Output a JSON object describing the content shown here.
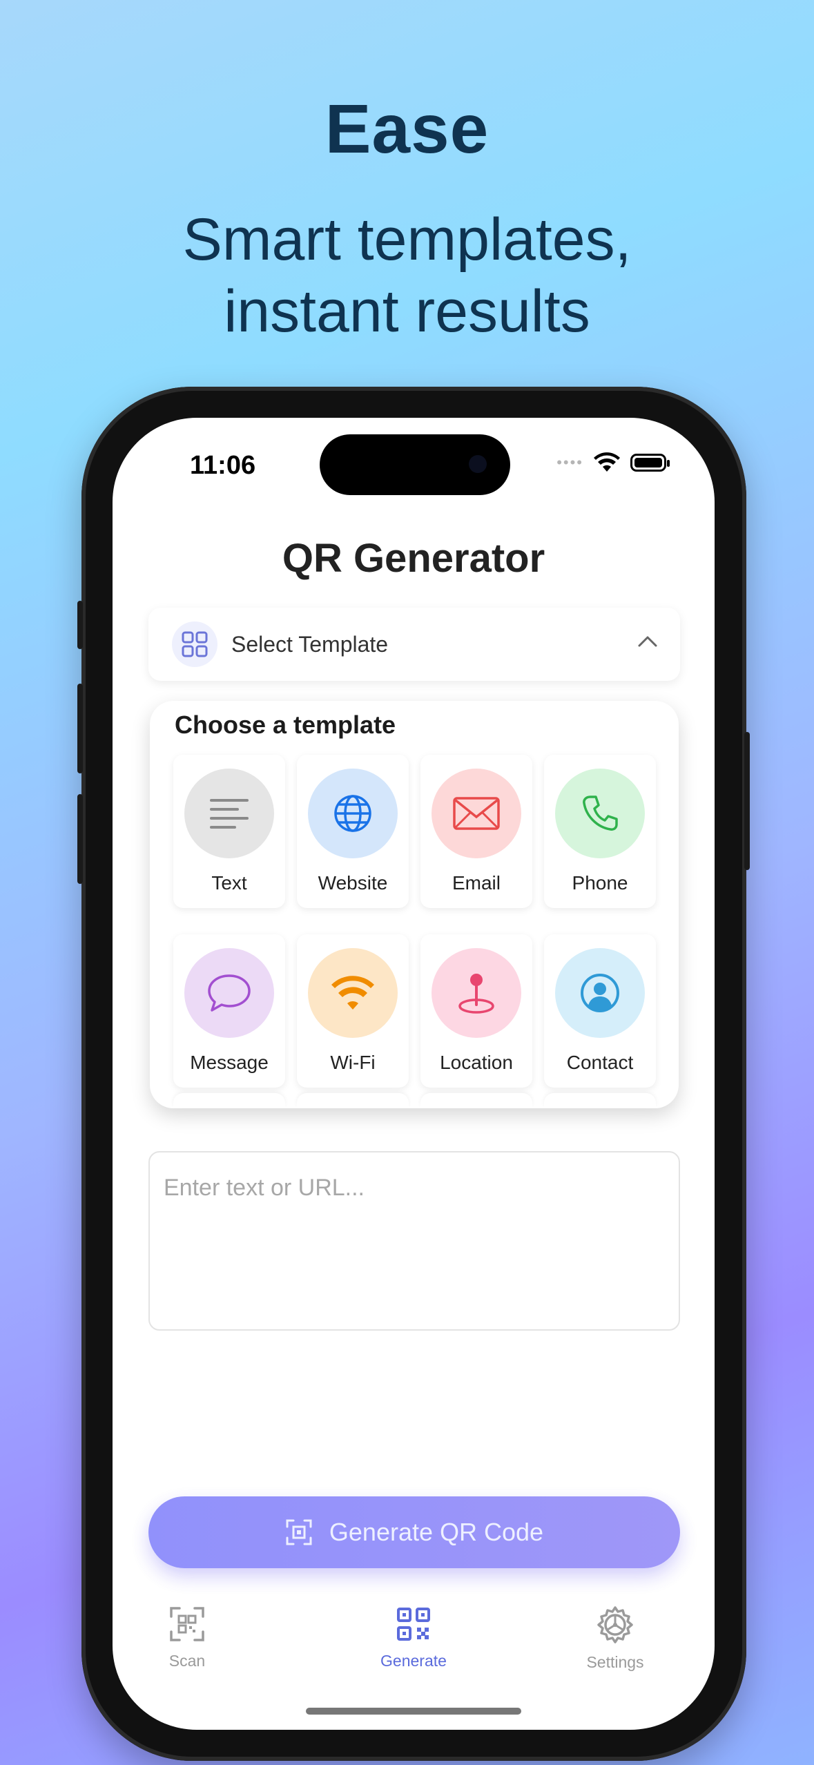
{
  "promo": {
    "title": "Ease",
    "subtitle_line1": "Smart templates,",
    "subtitle_line2": "instant results"
  },
  "status_bar": {
    "time": "11:06"
  },
  "app": {
    "title": "QR Generator",
    "template_select": {
      "label": "Select Template",
      "icon": "grid-icon",
      "expanded": true
    },
    "template_panel": {
      "title": "Choose a template",
      "templates": [
        {
          "label": "Text",
          "icon": "text-lines-icon",
          "bg": "#e5e5e5",
          "color": "#8a8a8a"
        },
        {
          "label": "Website",
          "icon": "globe-icon",
          "bg": "#d4e6fb",
          "color": "#1a73e8"
        },
        {
          "label": "Email",
          "icon": "envelope-icon",
          "bg": "#fdd8d8",
          "color": "#e84a4a"
        },
        {
          "label": "Phone",
          "icon": "phone-icon",
          "bg": "#d6f5dc",
          "color": "#2fb24c"
        },
        {
          "label": "Message",
          "icon": "chat-bubble-icon",
          "bg": "#ecdaf6",
          "color": "#a24fd0"
        },
        {
          "label": "Wi-Fi",
          "icon": "wifi-icon",
          "bg": "#fde6c6",
          "color": "#f08c00"
        },
        {
          "label": "Location",
          "icon": "location-pin-icon",
          "bg": "#fdd7e3",
          "color": "#e8466f"
        },
        {
          "label": "Contact",
          "icon": "person-circle-icon",
          "bg": "#d5eefa",
          "color": "#2f9ad6"
        }
      ]
    },
    "input": {
      "placeholder": "Enter text or URL...",
      "value": ""
    },
    "generate_button": {
      "label": "Generate QR Code",
      "icon": "qr-scan-icon"
    },
    "tabs": [
      {
        "label": "Scan",
        "icon": "qr-scan-frame-icon",
        "active": false
      },
      {
        "label": "Generate",
        "icon": "qr-code-icon",
        "active": true
      },
      {
        "label": "Settings",
        "icon": "gear-icon",
        "active": false
      }
    ],
    "accent_color": "#5b6bdc"
  }
}
